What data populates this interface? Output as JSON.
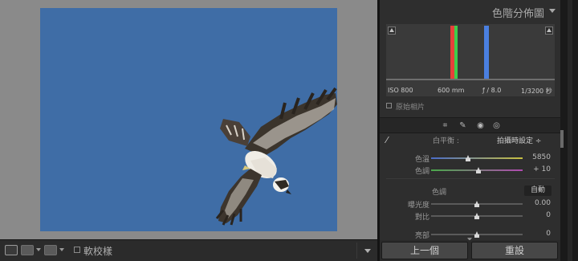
{
  "toolbar": {
    "soft_proof_label": "軟校樣"
  },
  "histogram": {
    "title": "色階分佈圖",
    "iso": "ISO 800",
    "focal_length": "600 mm",
    "aperture": "ƒ / 8.0",
    "shutter": "1/3200 秒",
    "original_photo_label": "原始相片",
    "channels": [
      {
        "name": "red",
        "color": "#e8413a"
      },
      {
        "name": "green",
        "color": "#3fcc4b"
      },
      {
        "name": "blue",
        "color": "#4a7fe0"
      }
    ]
  },
  "white_balance": {
    "label": "白平衡 :",
    "value": "拍攝時設定 ÷"
  },
  "sliders_wb": [
    {
      "label": "色溫",
      "value": "5850",
      "position": 0.4
    },
    {
      "label": "色調",
      "value": "+ 10",
      "position": 0.52
    }
  ],
  "tone": {
    "label": "色調",
    "auto_label": "自動"
  },
  "sliders_tone": [
    {
      "label": "曝光度",
      "value": "0.00",
      "position": 0.5
    },
    {
      "label": "對比",
      "value": "0",
      "position": 0.5
    },
    {
      "label": "亮部",
      "value": "0",
      "position": 0.5
    }
  ],
  "nav": {
    "previous_label": "上一個",
    "reset_label": "重設"
  },
  "colors": {
    "photo_sky": "#3f6da6",
    "panel_bg": "#2e2e2e"
  }
}
